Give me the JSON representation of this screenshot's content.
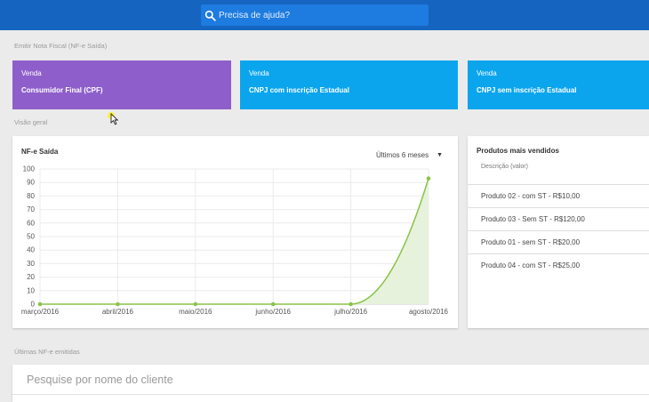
{
  "header": {
    "search_placeholder": "Precisa de ajuda?"
  },
  "emit_section": {
    "label": "Emitir Nota Fiscal (NF-e Saída)"
  },
  "cards": [
    {
      "kind": "Venda",
      "title": "Consumidor Final (CPF)",
      "color": "#8e5fcb"
    },
    {
      "kind": "Venda",
      "title": "CNPJ com inscrição Estadual",
      "color": "#0ba5ee"
    },
    {
      "kind": "Venda",
      "title": "CNPJ sem inscrição Estadual",
      "color": "#0ba5ee"
    }
  ],
  "overview": {
    "label": "Visão geral"
  },
  "chart_panel": {
    "title": "NF-e Saída",
    "range_label": "Últimos 6 meses"
  },
  "chart_data": {
    "type": "area",
    "title": "NF-e Saída",
    "categories": [
      "março/2016",
      "abril/2016",
      "maio/2016",
      "junho/2016",
      "julho/2016",
      "agosto/2016"
    ],
    "series": [
      {
        "values": [
          0,
          0,
          0,
          0,
          0,
          93
        ]
      }
    ],
    "ylim": [
      0,
      100
    ],
    "yticks": [
      0,
      10,
      20,
      30,
      40,
      50,
      60,
      70,
      80,
      90,
      100
    ],
    "grid": true,
    "line_color": "#8bc34a",
    "fill_color": "#e7f2dc"
  },
  "products": {
    "title": "Produtos mais vendidos",
    "subtitle": "Descrição (valor)",
    "items": [
      "Produto 02 - com ST - R$10,00",
      "Produto 03 - Sem ST - R$120,00",
      "Produto 01 - sem ST - R$20,00",
      "Produto 04 - com ST - R$25,00"
    ]
  },
  "last_section": {
    "label": "Últimas NF-e emitidas"
  },
  "client_search": {
    "placeholder": "Pesquise por nome do cliente"
  }
}
